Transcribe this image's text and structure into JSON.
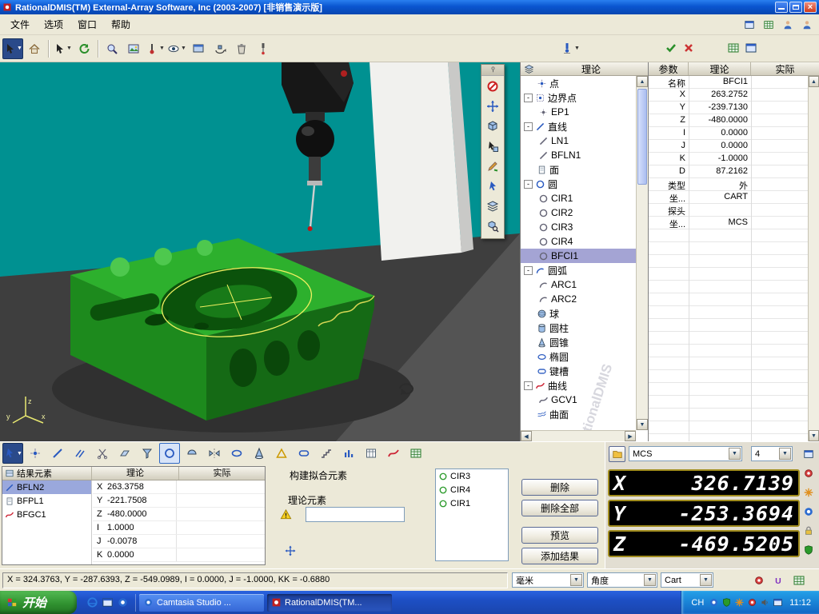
{
  "colors": {
    "titlebar_blue": "#0a55d0",
    "viewport_teal": "#009191",
    "part_green": "#2db02d",
    "selection_purple": "#a4a4d4",
    "dro_frame_gold": "#a08c1e",
    "dro_background": "#000000",
    "taskbar_blue": "#1d4fc4",
    "start_green": "#2e8f2e"
  },
  "title_bar": {
    "title": "RationalDMIS(TM) External-Array Software, Inc (2003-2007) [非销售演示版]"
  },
  "menu_bar": {
    "items": [
      "文件",
      "选项",
      "窗口",
      "帮助"
    ],
    "right_icons": [
      "window-blue",
      "grid-green",
      "person",
      "person"
    ]
  },
  "main_toolbar": {
    "buttons": [
      {
        "icon": "cursor",
        "style": "dark",
        "dropdown": true
      },
      {
        "icon": "home"
      },
      "|",
      {
        "icon": "cursor",
        "dropdown": true
      },
      {
        "icon": "refresh"
      },
      "|",
      {
        "icon": "zoom"
      },
      {
        "icon": "image"
      },
      {
        "icon": "probe-axis",
        "dropdown": true
      },
      {
        "icon": "eye",
        "dropdown": true
      },
      {
        "icon": "capture-window"
      },
      {
        "icon": "rotate-view"
      },
      {
        "icon": "trash"
      },
      {
        "icon": "probe-tool"
      }
    ],
    "extras": [
      {
        "icon": "probe-blue",
        "dropdown": true
      },
      {
        "icon": "check"
      },
      {
        "icon": "red-x"
      },
      {
        "icon": "grid-green"
      },
      {
        "icon": "window-blue"
      }
    ]
  },
  "viewport": {
    "axis_labels": [
      "z",
      "x",
      "y"
    ]
  },
  "float_toolbar": {
    "buttons": [
      {
        "icon": "no-entry"
      },
      {
        "icon": "move-arrows"
      },
      {
        "icon": "cube"
      },
      {
        "icon": "pick"
      },
      {
        "icon": "pencil"
      },
      {
        "icon": "pointer-blue"
      },
      {
        "icon": "layers"
      },
      {
        "icon": "inspect-cube"
      }
    ]
  },
  "tree_panel": {
    "header": "理论",
    "watermark": "RationalDMIS",
    "items": [
      {
        "label": "点",
        "depth": 0,
        "icon": "point",
        "expand": false
      },
      {
        "label": "边界点",
        "depth": 0,
        "icon": "boundary-point",
        "expand": true
      },
      {
        "label": "EP1",
        "depth": 1,
        "icon": "point-gray"
      },
      {
        "label": "直线",
        "depth": 0,
        "icon": "line",
        "expand": true
      },
      {
        "label": "LN1",
        "depth": 1,
        "icon": "line-gray"
      },
      {
        "label": "BFLN1",
        "depth": 1,
        "icon": "line-gray"
      },
      {
        "label": "面",
        "depth": 0,
        "icon": "page",
        "expand": false
      },
      {
        "label": "圆",
        "depth": 0,
        "icon": "circle-blue",
        "expand": true
      },
      {
        "label": "CIR1",
        "depth": 1,
        "icon": "circle-gray"
      },
      {
        "label": "CIR2",
        "depth": 1,
        "icon": "circle-gray"
      },
      {
        "label": "CIR3",
        "depth": 1,
        "icon": "circle-gray"
      },
      {
        "label": "CIR4",
        "depth": 1,
        "icon": "circle-gray"
      },
      {
        "label": "BFCI1",
        "depth": 1,
        "icon": "circle-gray",
        "selected": true
      },
      {
        "label": "圆弧",
        "depth": 0,
        "icon": "arc",
        "expand": true
      },
      {
        "label": "ARC1",
        "depth": 1,
        "icon": "arc-gray"
      },
      {
        "label": "ARC2",
        "depth": 1,
        "icon": "arc-gray"
      },
      {
        "label": "球",
        "depth": 0,
        "icon": "sphere",
        "expand": false
      },
      {
        "label": "圆柱",
        "depth": 0,
        "icon": "cylinder",
        "expand": false
      },
      {
        "label": "圆锥",
        "depth": 0,
        "icon": "cone",
        "expand": false
      },
      {
        "label": "椭圆",
        "depth": 0,
        "icon": "ellipse-icon",
        "expand": false
      },
      {
        "label": "键槽",
        "depth": 0,
        "icon": "slot",
        "expand": false
      },
      {
        "label": "曲线",
        "depth": 0,
        "icon": "curve-red",
        "expand": true
      },
      {
        "label": "GCV1",
        "depth": 1,
        "icon": "curve-gray"
      },
      {
        "label": "曲面",
        "depth": 0,
        "icon": "surface",
        "expand": false
      }
    ]
  },
  "properties_panel": {
    "columns": [
      "参数",
      "理论",
      "实际"
    ],
    "rows": [
      {
        "param": "名称",
        "theo": "BFCI1",
        "actual": ""
      },
      {
        "param": "X",
        "theo": "263.2752",
        "actual": ""
      },
      {
        "param": "Y",
        "theo": "-239.7130",
        "actual": ""
      },
      {
        "param": "Z",
        "theo": "-480.0000",
        "actual": ""
      },
      {
        "param": "I",
        "theo": "0.0000",
        "actual": ""
      },
      {
        "param": "J",
        "theo": "0.0000",
        "actual": ""
      },
      {
        "param": "K",
        "theo": "-1.0000",
        "actual": ""
      },
      {
        "param": "D",
        "theo": "87.2162",
        "actual": ""
      },
      {
        "param": "类型",
        "theo": "外",
        "actual": ""
      },
      {
        "param": "坐...",
        "theo": "CART",
        "actual": ""
      },
      {
        "param": "探头",
        "theo": "",
        "actual": ""
      },
      {
        "param": "坐...",
        "theo": "MCS",
        "actual": ""
      }
    ]
  },
  "bottom_toolbar": {
    "buttons": [
      {
        "icon": "pointer-blue",
        "style": "dark",
        "dropdown": true
      },
      {
        "icon": "point"
      },
      {
        "icon": "line"
      },
      {
        "icon": "parallel"
      },
      {
        "icon": "cut"
      },
      {
        "icon": "plane"
      },
      {
        "icon": "funnel"
      },
      {
        "icon": "circle-blue",
        "pressed": true
      },
      {
        "icon": "semicircle"
      },
      {
        "icon": "mirror"
      },
      {
        "icon": "ellipse-icon"
      },
      {
        "icon": "cone"
      },
      {
        "icon": "triangle-outline"
      },
      {
        "icon": "slot"
      },
      {
        "icon": "stairs"
      },
      {
        "icon": "bars"
      },
      {
        "icon": "columns"
      },
      {
        "icon": "curve-red"
      },
      {
        "icon": "grid-green"
      }
    ]
  },
  "results_panel": {
    "title": "结果元素",
    "columns": [
      "理论",
      "实际"
    ],
    "items": [
      {
        "label": "BFLN2",
        "icon": "line",
        "selected": true
      },
      {
        "label": "BFPL1",
        "icon": "page"
      },
      {
        "label": "BFGC1",
        "icon": "curve-red"
      }
    ],
    "values": [
      {
        "param": "X",
        "theo": "263.3758",
        "actual": ""
      },
      {
        "param": "Y",
        "theo": "-221.7508",
        "actual": ""
      },
      {
        "param": "Z",
        "theo": "-480.0000",
        "actual": ""
      },
      {
        "param": "I",
        "theo": "1.0000",
        "actual": ""
      },
      {
        "param": "J",
        "theo": "-0.0078",
        "actual": ""
      },
      {
        "param": "K",
        "theo": "0.0000",
        "actual": ""
      }
    ]
  },
  "construct_panel": {
    "title": "构建拟合元素",
    "field_label": "理论元素",
    "input_value": "",
    "elements": [
      {
        "label": "CIR3",
        "icon": "circle-green"
      },
      {
        "label": "CIR4",
        "icon": "circle-green"
      },
      {
        "label": "CIR1",
        "icon": "circle-green"
      }
    ]
  },
  "action_buttons": [
    "删除",
    "删除全部",
    "预览",
    "添加结果"
  ],
  "dro": {
    "cs": "MCS",
    "count": "4",
    "axes": [
      {
        "label": "X",
        "value": "326.7139"
      },
      {
        "label": "Y",
        "value": "-253.3694"
      },
      {
        "label": "Z",
        "value": "-469.5205"
      }
    ],
    "side_icons": [
      "window-blue",
      "target-red",
      "gear",
      "camtasia",
      "lock",
      "shield-green"
    ]
  },
  "status_bar": {
    "coords": "X = 324.3763, Y = -287.6393, Z = -549.0989, I = 0.0000, J = -1.0000, KK = -0.6880",
    "units": "毫米",
    "angle": "角度",
    "cs": "Cart",
    "icons": [
      "target-red",
      "u-mark",
      "grid-green"
    ]
  },
  "taskbar": {
    "start": "开始",
    "quick_launch": [
      "ie",
      "window-blue",
      "camtasia"
    ],
    "tasks": [
      {
        "label": "Camtasia Studio ...",
        "icon": "camtasia",
        "active": false
      },
      {
        "label": "RationalDMIS(TM...",
        "icon": "rational",
        "active": true
      }
    ],
    "tray": {
      "lang": "CH",
      "icons": [
        "camtasia",
        "shield-green",
        "gear",
        "target-red",
        "speaker",
        "window-blue"
      ],
      "time": "11:12"
    }
  }
}
